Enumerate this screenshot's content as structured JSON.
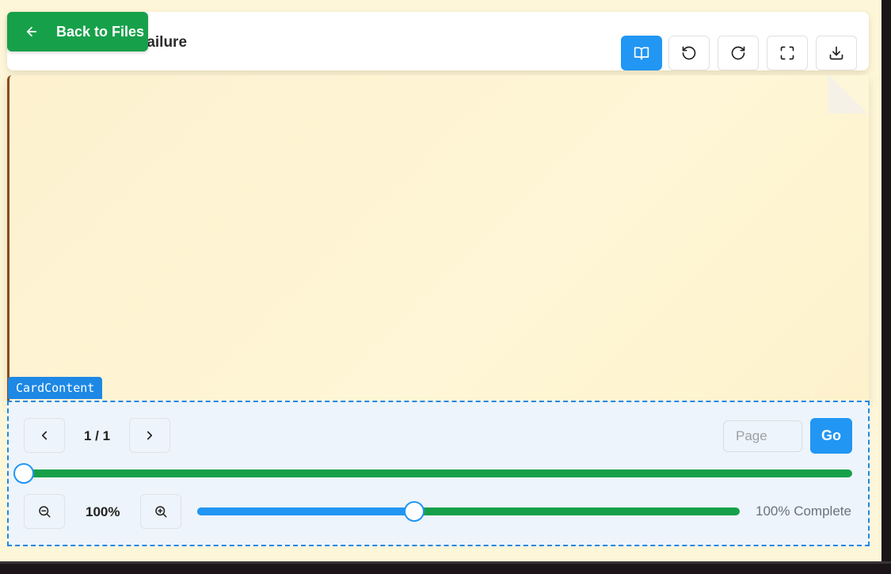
{
  "header": {
    "back_label": "Back to Files",
    "title_visible": "failure",
    "tools": [
      {
        "name": "reading-mode-icon",
        "active": true
      },
      {
        "name": "rotate-left-icon",
        "active": false
      },
      {
        "name": "rotate-right-icon",
        "active": false
      },
      {
        "name": "fullscreen-icon",
        "active": false
      },
      {
        "name": "download-icon",
        "active": false
      }
    ]
  },
  "debug_label": "CardContent",
  "pagination": {
    "indicator": "1 / 1",
    "page_placeholder": "Page",
    "go_label": "Go",
    "page_progress": 0
  },
  "zoom": {
    "level": "100%",
    "slider_fraction": 0.4
  },
  "status": {
    "text": "100% Complete"
  },
  "colors": {
    "primary_green": "#17a04a",
    "primary_blue": "#2196f3",
    "page_bg": "#fdf6d8",
    "card_bg": "#edf4fb"
  }
}
